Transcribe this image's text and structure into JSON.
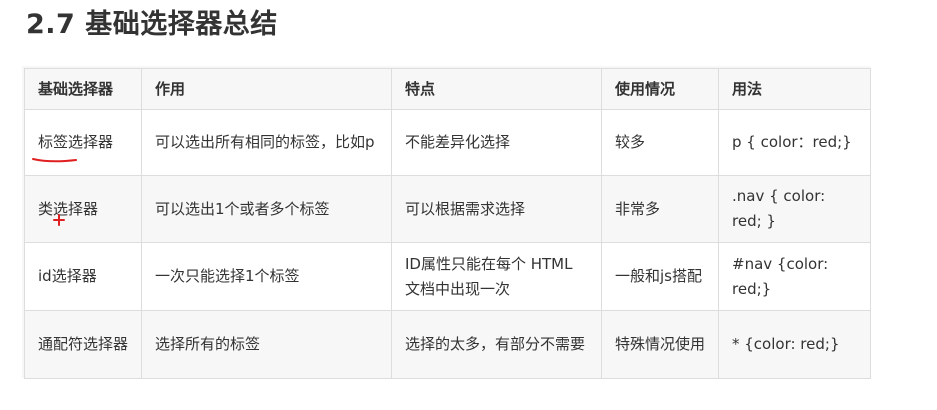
{
  "heading": "2.7 基础选择器总结",
  "table": {
    "headers": [
      "基础选择器",
      "作用",
      "特点",
      "使用情况",
      "用法"
    ],
    "rows": [
      [
        "标签选择器",
        "可以选出所有相同的标签，比如p",
        "不能差异化选择",
        "较多",
        "p { color：red;}"
      ],
      [
        "类选择器",
        "可以选出1个或者多个标签",
        "可以根据需求选择",
        "非常多",
        ".nav { color: red; }"
      ],
      [
        "id选择器",
        "一次只能选择1个标签",
        "ID属性只能在每个 HTML 文档中出现一次",
        "一般和js搭配",
        "#nav {color: red;}"
      ],
      [
        "通配符选择器",
        "选择所有的标签",
        "选择的太多，有部分不需要",
        "特殊情况使用",
        "* {color: red;}"
      ]
    ]
  },
  "colors": {
    "annotation": "#e02020",
    "border": "#dddddd",
    "header_bg": "#f7f7f7",
    "text": "#333333"
  }
}
